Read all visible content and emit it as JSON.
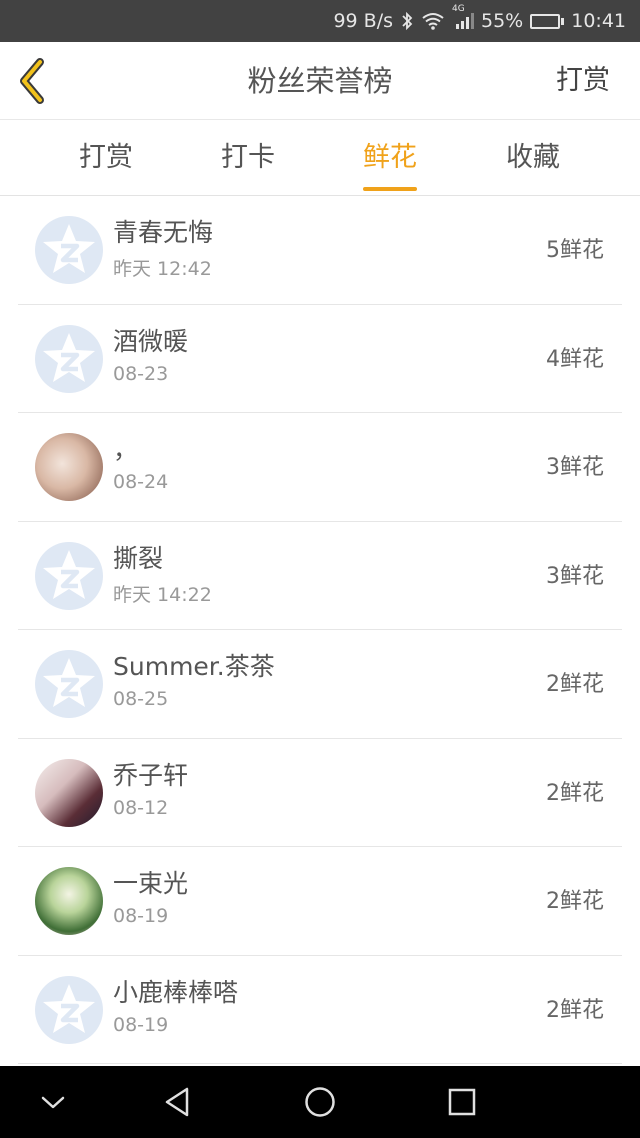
{
  "status_bar": {
    "net_speed": "99 B/s",
    "signal_badge": "4G",
    "battery": "55%",
    "battery_level": 0.55,
    "time": "10:41"
  },
  "header": {
    "title": "粉丝荣誉榜",
    "action_label": "打赏"
  },
  "tabs": [
    {
      "label": "打赏",
      "active": false
    },
    {
      "label": "打卡",
      "active": false
    },
    {
      "label": "鲜花",
      "active": true
    },
    {
      "label": "收藏",
      "active": false
    }
  ],
  "accent_color": "#f0a21a",
  "fans": [
    {
      "name": "青春无悔",
      "time": "昨天 12:42",
      "count": "5鲜花",
      "avatar": "placeholder"
    },
    {
      "name": "酒微暖",
      "time": "08-23",
      "count": "4鲜花",
      "avatar": "placeholder"
    },
    {
      "name": "，",
      "time": "08-24",
      "count": "3鲜花",
      "avatar": "photo1"
    },
    {
      "name": "撕裂",
      "time": "昨天 14:22",
      "count": "3鲜花",
      "avatar": "placeholder"
    },
    {
      "name": "Summer.茶茶",
      "time": "08-25",
      "count": "2鲜花",
      "avatar": "placeholder"
    },
    {
      "name": "乔子轩",
      "time": "08-12",
      "count": "2鲜花",
      "avatar": "photo2"
    },
    {
      "name": "一束光",
      "time": "08-19",
      "count": "2鲜花",
      "avatar": "photo3"
    },
    {
      "name": "小鹿棒棒嗒",
      "time": "08-19",
      "count": "2鲜花",
      "avatar": "placeholder"
    }
  ],
  "icons": {
    "back": "chevron-left-icon",
    "placeholder_avatar": "qzone-star-icon",
    "nav": [
      "chevron-down-icon",
      "back-triangle-icon",
      "home-circle-icon",
      "recents-square-icon"
    ]
  }
}
